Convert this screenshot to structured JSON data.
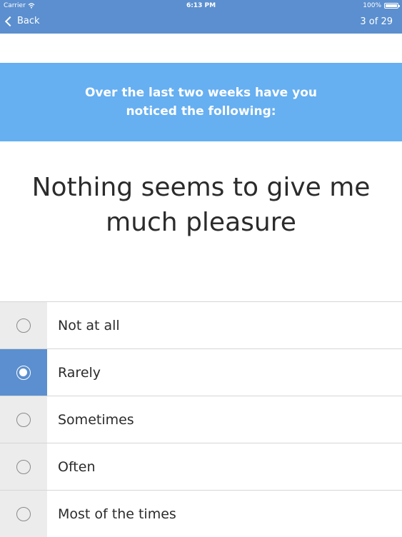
{
  "status_bar": {
    "carrier": "Carrier",
    "time": "6:13 PM",
    "battery": "100%",
    "battery_level": 1.0
  },
  "nav": {
    "back_label": "Back",
    "progress": "3 of 29"
  },
  "banner": {
    "line1": "Over the last two weeks have you",
    "line2": "noticed the following:"
  },
  "question": {
    "line1": "Nothing seems to give me",
    "line2": "much pleasure"
  },
  "options": [
    {
      "label": "Not at all",
      "selected": false
    },
    {
      "label": "Rarely",
      "selected": true
    },
    {
      "label": "Sometimes",
      "selected": false
    },
    {
      "label": "Often",
      "selected": false
    },
    {
      "label": "Most of the times",
      "selected": false
    }
  ],
  "colors": {
    "nav_bar": "#5b8fcf",
    "banner": "#66aff1",
    "selected_cell": "#5b8fcf",
    "radio_cell": "#ececec"
  }
}
